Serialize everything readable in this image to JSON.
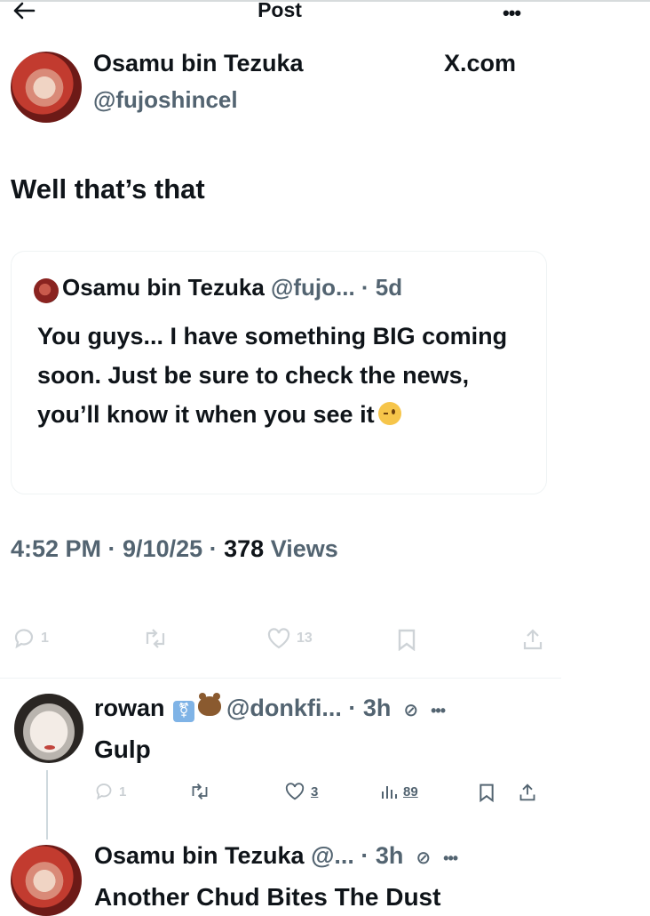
{
  "topbar": {
    "title": "Post"
  },
  "post": {
    "author_name": "Osamu bin Tezuka",
    "author_handle": "@fujoshincel",
    "site_label": "X.com",
    "text": "Well that’s that",
    "timestamp": "4:52 PM · 9/10/25 · ",
    "views_count": "378",
    "views_label": " Views"
  },
  "quote": {
    "author_name": "Osamu bin Tezuka ",
    "handle_time": "@fujo... · 5d",
    "text": "You guys... I have something BIG coming soon. Just be sure to check the news, you’ll know it when you see it"
  },
  "actions": {
    "replies": "1",
    "likes": "13"
  },
  "replies": [
    {
      "name": "rowan ",
      "handle_time": "@donkfi... · 3h",
      "text": "Gulp",
      "replies": "1",
      "likes": "3",
      "views": "89"
    },
    {
      "name": "Osamu bin Tezuka ",
      "handle_time": "@... · 3h",
      "text": "Another Chud Bites The Dust"
    }
  ],
  "colors": {
    "text": "#0f1419",
    "secondary": "#536471",
    "border": "#eff3f4",
    "thread": "#cfd9de"
  },
  "icons": [
    "back-arrow-icon",
    "more-icon",
    "reply-icon",
    "repost-icon",
    "like-icon",
    "bookmark-icon",
    "share-icon",
    "views-icon",
    "grok-icon"
  ]
}
